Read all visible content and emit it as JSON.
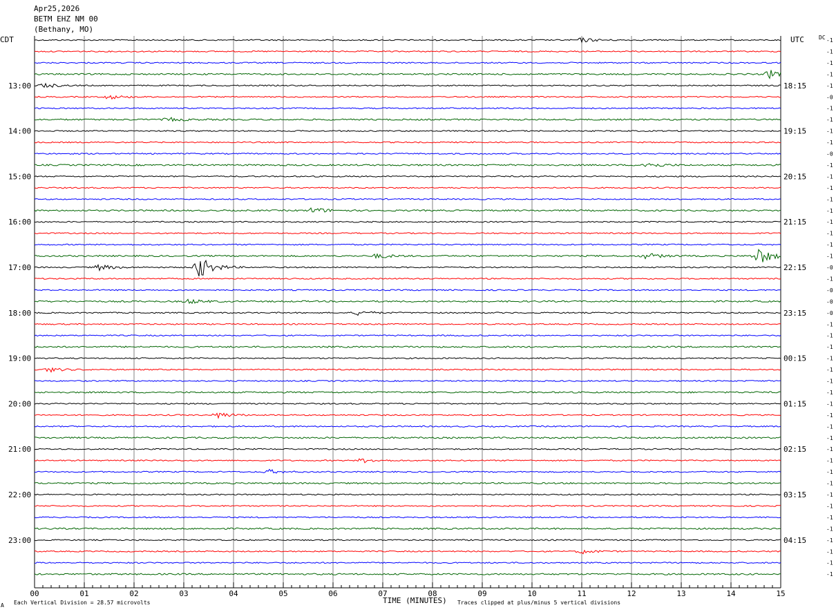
{
  "header": {
    "date": "Apr25,2026",
    "station": "BETM EHZ NM 00",
    "location": "(Bethany, MO)"
  },
  "left_axis_title": "CDT",
  "right_axis_title": "UTC",
  "dc_header": "DC",
  "chart_data": {
    "type": "line",
    "title": "",
    "xlabel": "TIME (MINUTES)",
    "ylabel": "",
    "x_range_minutes": [
      0,
      15
    ],
    "x_tick_labels": [
      "00",
      "01",
      "02",
      "03",
      "04",
      "05",
      "06",
      "07",
      "08",
      "09",
      "10",
      "11",
      "12",
      "13",
      "14",
      "15"
    ],
    "rows_per_hour": 4,
    "row_count": 48,
    "left_hour_labels": [
      {
        "row": 4,
        "label": "13:00"
      },
      {
        "row": 8,
        "label": "14:00"
      },
      {
        "row": 12,
        "label": "15:00"
      },
      {
        "row": 16,
        "label": "16:00"
      },
      {
        "row": 20,
        "label": "17:00"
      },
      {
        "row": 24,
        "label": "18:00"
      },
      {
        "row": 28,
        "label": "19:00"
      },
      {
        "row": 32,
        "label": "20:00"
      },
      {
        "row": 36,
        "label": "21:00"
      },
      {
        "row": 40,
        "label": "22:00"
      },
      {
        "row": 44,
        "label": "23:00"
      }
    ],
    "right_hour_labels": [
      {
        "row": 4,
        "label": "18:15"
      },
      {
        "row": 8,
        "label": "19:15"
      },
      {
        "row": 12,
        "label": "20:15"
      },
      {
        "row": 16,
        "label": "21:15"
      },
      {
        "row": 20,
        "label": "22:15"
      },
      {
        "row": 24,
        "label": "23:15"
      },
      {
        "row": 28,
        "label": "00:15"
      },
      {
        "row": 32,
        "label": "01:15"
      },
      {
        "row": 36,
        "label": "02:15"
      },
      {
        "row": 40,
        "label": "03:15"
      },
      {
        "row": 44,
        "label": "04:15"
      }
    ],
    "trace_colors": [
      "#000000",
      "#ff0000",
      "#0000ff",
      "#006400"
    ],
    "dc_offsets": [
      "-1",
      "-1",
      "-1",
      "-1",
      "-1",
      "-0",
      "-1",
      "-1",
      "-1",
      "-1",
      "-0",
      "-1",
      "-1",
      "-1",
      "-1",
      "-1",
      "-1",
      "-1",
      "-1",
      "-1",
      "-0",
      "-1",
      "-0",
      "-0",
      "-0",
      "-1",
      "-1",
      "-1",
      "-1",
      "-1",
      "-1",
      "-1",
      "-1",
      "-1",
      "-1",
      "-1",
      "-1",
      "-1",
      "-1",
      "-1",
      "-1",
      "-1",
      "-1",
      "-1",
      "-1",
      "-1",
      "-1",
      "-1"
    ],
    "events": [
      {
        "row": 0,
        "minute": 11.0,
        "amp": 3
      },
      {
        "row": 3,
        "minute": 14.8,
        "amp": 6
      },
      {
        "row": 4,
        "minute": 0.2,
        "amp": 3
      },
      {
        "row": 5,
        "minute": 1.5,
        "amp": 3
      },
      {
        "row": 7,
        "minute": 2.7,
        "amp": 2.5
      },
      {
        "row": 11,
        "minute": 12.3,
        "amp": 4
      },
      {
        "row": 15,
        "minute": 5.6,
        "amp": 4
      },
      {
        "row": 19,
        "minute": 14.55,
        "amp": 12
      },
      {
        "row": 19,
        "minute": 12.3,
        "amp": 4
      },
      {
        "row": 19,
        "minute": 6.9,
        "amp": 3
      },
      {
        "row": 20,
        "minute": 3.3,
        "amp": 16
      },
      {
        "row": 20,
        "minute": 1.3,
        "amp": 4
      },
      {
        "row": 23,
        "minute": 3.1,
        "amp": 3
      },
      {
        "row": 24,
        "minute": 6.5,
        "amp": 3
      },
      {
        "row": 29,
        "minute": 0.3,
        "amp": 3
      },
      {
        "row": 33,
        "minute": 3.7,
        "amp": 4
      },
      {
        "row": 37,
        "minute": 6.6,
        "amp": 3
      },
      {
        "row": 38,
        "minute": 4.7,
        "amp": 3
      },
      {
        "row": 45,
        "minute": 11.0,
        "amp": 3
      }
    ]
  },
  "footer": {
    "scale_note": "Each Vertical Division =   28.57 microvolts",
    "clip_note": "Traces clipped at plus/minus 5 vertical divisions",
    "corner_mark": "A"
  }
}
